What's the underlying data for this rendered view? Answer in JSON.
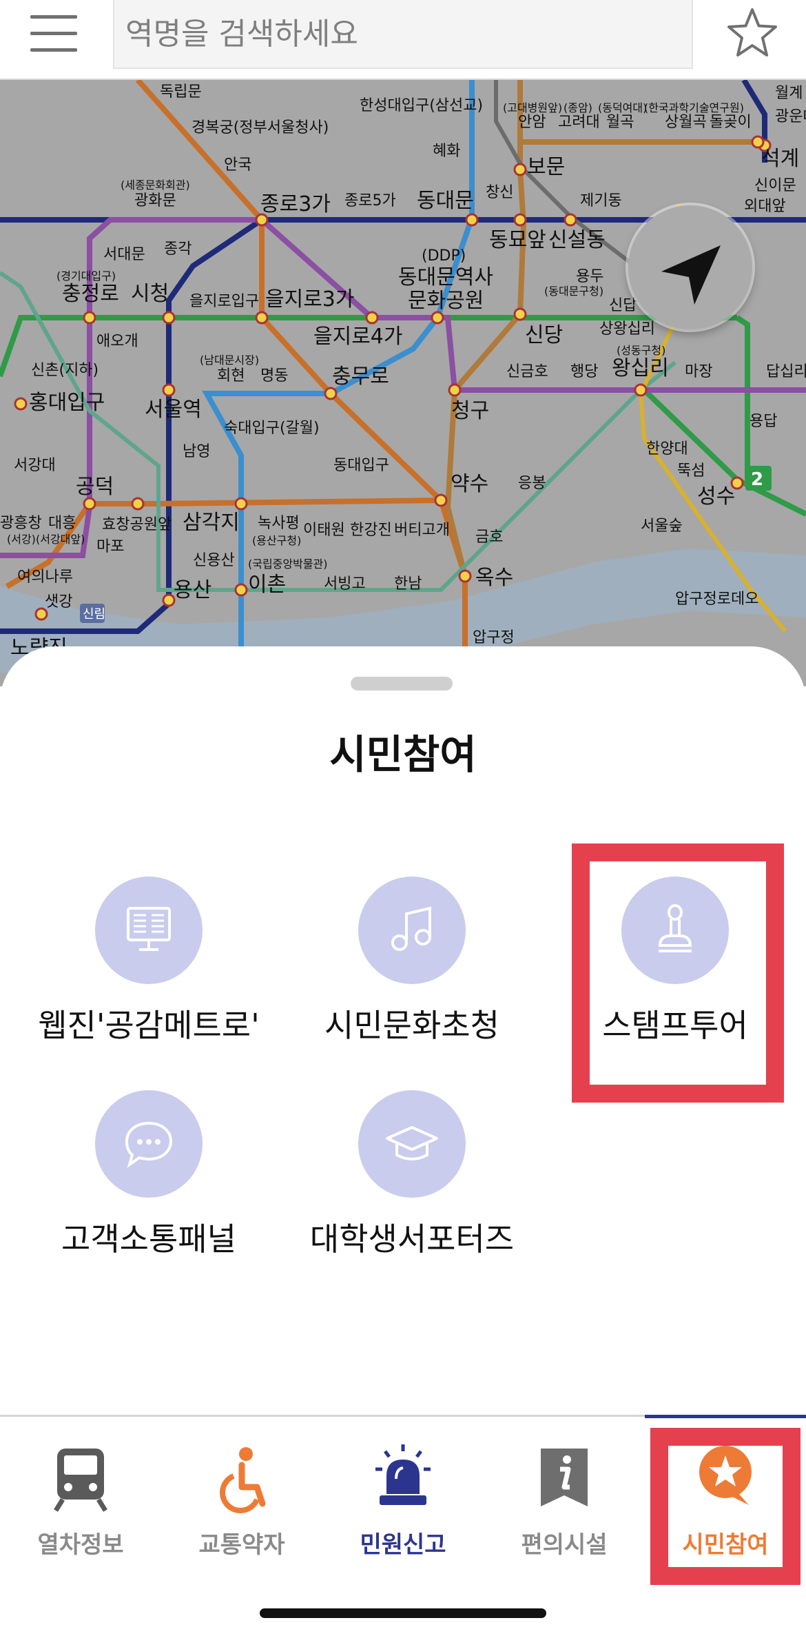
{
  "header": {
    "menu_icon": "hamburger-icon",
    "search_placeholder": "역명을 검색하세요",
    "favorite_icon": "star-outline-icon"
  },
  "map": {
    "locate_icon": "location-arrow-icon",
    "stations": [
      "독립문",
      "경복궁(정부서울청사)",
      "안국",
      "(세종문화회관)",
      "광화문",
      "종로3가",
      "종로5가",
      "동대문",
      "혜화",
      "한성대입구(삼선교)",
      "(고대병원앞)",
      "안암",
      "(종암)",
      "고려대",
      "(동덕여대)",
      "월곡",
      "(한국과학기술연구원)",
      "상월곡",
      "돌곶이",
      "월계",
      "광운대",
      "석계",
      "신이문",
      "외대앞",
      "보문",
      "창신",
      "제기동",
      "동묘앞",
      "신설동",
      "서대문",
      "종각",
      "(경기대입구)",
      "충정로",
      "시청",
      "을지로입구",
      "을지로3가",
      "(DDP)",
      "동대문역사",
      "문화공원",
      "용두",
      "(동대문구청)",
      "신답",
      "상왕십리",
      "(성동구청)",
      "왕십리",
      "애오개",
      "을지로4가",
      "신당",
      "신촌(지하)",
      "(남대문시장)",
      "회현",
      "명동",
      "충무로",
      "신금호",
      "행당",
      "마장",
      "답십리",
      "홍대입구",
      "서울역",
      "청구",
      "용답",
      "숙대입구(갈월)",
      "남영",
      "한양대",
      "뚝섬",
      "동대입구",
      "성수",
      "서강대",
      "공덕",
      "약수",
      "응봉",
      "효창공원앞",
      "삼각지",
      "녹사평",
      "(용산구청)",
      "이태원",
      "한강진",
      "버티고개",
      "금호",
      "서울숲",
      "광흥창",
      "(서강)",
      "대흥",
      "(서강대앞)",
      "마포",
      "신용산",
      "(국립중앙박물관)",
      "이촌",
      "서빙고",
      "한남",
      "옥수",
      "여의나루",
      "용산",
      "압구정로데오",
      "샛강",
      "신림",
      "노량진",
      "압구정"
    ],
    "line_badge": "2"
  },
  "sheet": {
    "title": "시민참여",
    "items": [
      {
        "label": "웹진'공감메트로'",
        "icon": "monitor-document-icon"
      },
      {
        "label": "시민문화초청",
        "icon": "music-note-icon"
      },
      {
        "label": "스탬프투어",
        "icon": "stamp-icon"
      },
      {
        "label": "고객소통패널",
        "icon": "chat-bubble-icon"
      },
      {
        "label": "대학생서포터즈",
        "icon": "graduation-cap-icon"
      }
    ]
  },
  "bottom_nav": {
    "items": [
      {
        "label": "열차정보",
        "icon": "train-icon",
        "color": "#8a8a8a"
      },
      {
        "label": "교통약자",
        "icon": "wheelchair-icon",
        "color": "#8a8a8a"
      },
      {
        "label": "민원신고",
        "icon": "siren-icon",
        "color": "#2b3590"
      },
      {
        "label": "편의시설",
        "icon": "info-icon",
        "color": "#8a8a8a"
      },
      {
        "label": "시민참여",
        "icon": "star-bubble-icon",
        "color": "#ee7b35"
      }
    ],
    "active_index": 4
  },
  "colors": {
    "highlight": "#e5404e",
    "circle_bg": "#c9cced",
    "accent_orange": "#ee7b35",
    "accent_navy": "#2b3590"
  }
}
